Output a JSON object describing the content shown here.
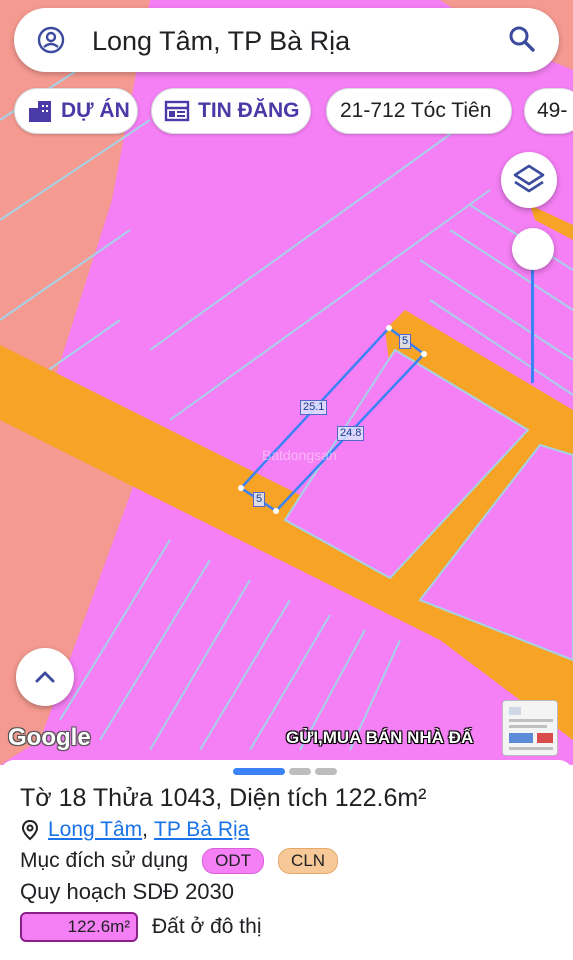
{
  "search": {
    "query": "Long Tâm, TP Bà Rịa",
    "account_icon": "account-circle-icon",
    "search_icon": "search-icon"
  },
  "chips": [
    {
      "label": "DỰ ÁN",
      "icon": "project-building-icon"
    },
    {
      "label": "TIN ĐĂNG",
      "icon": "listing-icon"
    },
    {
      "label": "21-712 Tóc Tiên"
    },
    {
      "label": "49-"
    }
  ],
  "map": {
    "colors": {
      "residential": "#f57ff5",
      "perennial": "#f59a90",
      "road": "#f7a325",
      "parcel_border": "#3b82f6",
      "lot_lines": "#a6d2e8"
    },
    "parcel_labels": {
      "top_edge": "5",
      "left_edge": "25.1",
      "right_edge": "24.8",
      "bottom_edge": "5"
    },
    "zoom_level_fraction": 0.82,
    "google_logo": "Google",
    "watermark": "GỬI,MUA BÁN NHÀ ĐẤ",
    "faint_watermark": "Batdongsan"
  },
  "sheet": {
    "title_sheet_parcel": "Tờ 18 Thửa 1043, Diện tích 122.6m²",
    "location_ward": "Long Tâm",
    "location_sep": ",",
    "location_city": "TP Bà Rịa",
    "usage_label": "Mục đích sử dụng",
    "usage_badges": [
      {
        "code": "ODT",
        "color": "#f57ff5"
      },
      {
        "code": "CLN",
        "color": "#f7c998"
      }
    ],
    "plan_label": "Quy hoạch SDĐ 2030",
    "plan_area": "122.6m²",
    "plan_use": "Đất ở đô thị",
    "plan_color": "#f57ff5"
  }
}
